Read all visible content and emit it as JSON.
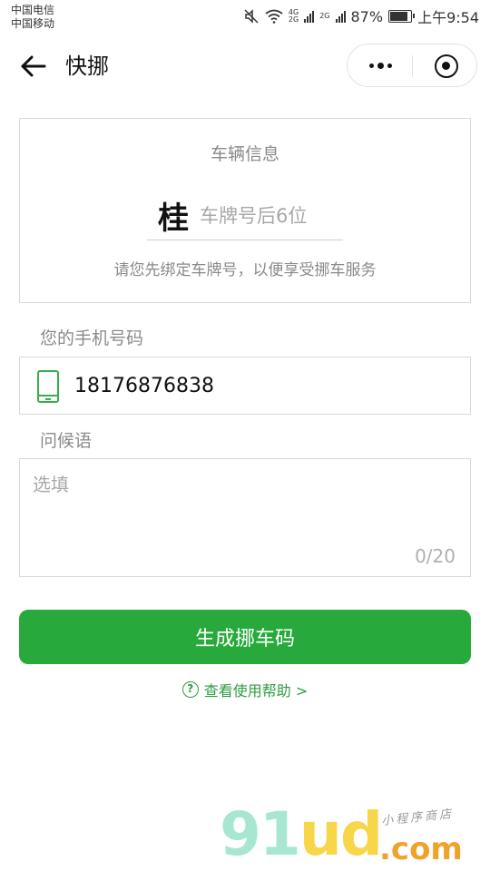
{
  "status_bar": {
    "carrier_1": "中国电信",
    "carrier_2": "中国移动",
    "network_1": "4G",
    "network_2": "2G",
    "network_3": "2G",
    "battery": "87%",
    "battery_level": 0.87,
    "time": "上午9:54"
  },
  "nav": {
    "title": "快挪",
    "icons": [
      "back-arrow-icon",
      "more-dots-icon",
      "target-close-icon"
    ]
  },
  "vehicle": {
    "title": "车辆信息",
    "province": "桂",
    "plate_placeholder": "车牌号后6位",
    "hint": "请您先绑定车牌号，以便享受挪车服务"
  },
  "phone": {
    "label": "您的手机号码",
    "value": "18176876838",
    "icon": "phone-icon"
  },
  "greeting": {
    "label": "问候语",
    "placeholder": "选填",
    "counter": "0/20"
  },
  "actions": {
    "generate_button": "生成挪车码",
    "help_link": "查看使用帮助 >",
    "help_icon_glyph": "?"
  },
  "watermark": {
    "brand_part_1": "91",
    "brand_part_2": "ud",
    "domain": ".com",
    "tagline": "小程序商店"
  },
  "colors": {
    "primary": "#27a93c",
    "link": "#2f9c42",
    "border": "#d9d9d9"
  }
}
